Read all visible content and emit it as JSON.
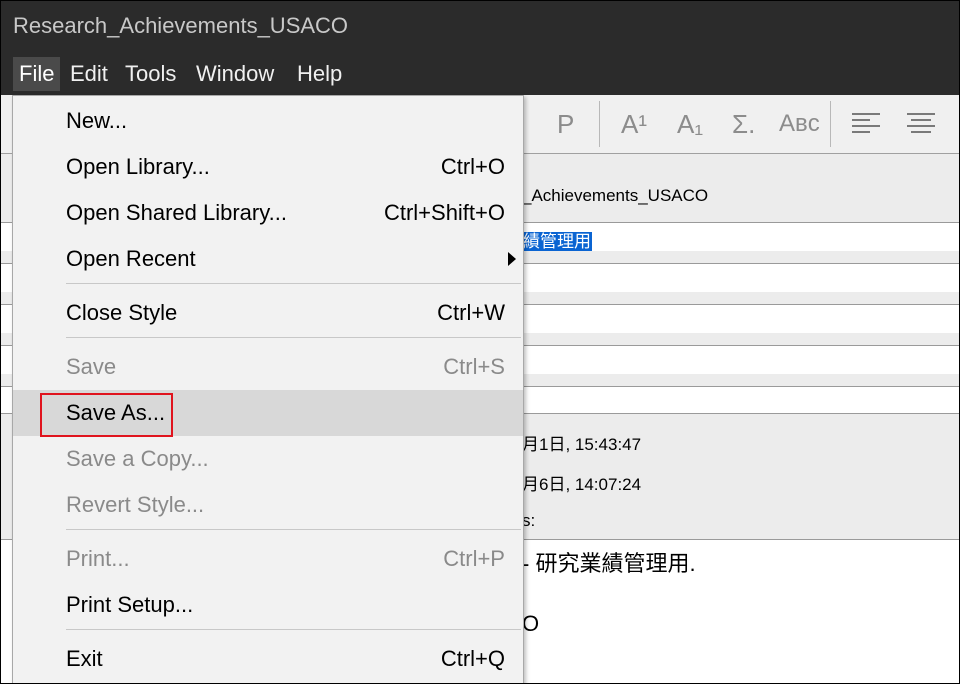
{
  "window": {
    "title": "Research_Achievements_USACO"
  },
  "menubar": {
    "items": [
      "File",
      "Edit",
      "Tools",
      "Window",
      "Help"
    ]
  },
  "toolbar": {
    "bold_glyph": "P",
    "superscript_glyph": "A¹",
    "subscript_glyph": "A₁",
    "symbol_glyph": "Σ.",
    "smallcaps_glyph": "Aʙᴄ"
  },
  "content": {
    "name_partial": "_Achievements_USACO",
    "selected_partial": "績管理用",
    "created_partial": "月1日, 15:43:47",
    "modified_partial": "月6日, 14:07:24",
    "label_partial": "s:",
    "description_partial": "- 研究業績管理用.",
    "extra_partial": "O"
  },
  "file_menu": {
    "new": "New...",
    "open_library": {
      "label": "Open Library...",
      "shortcut": "Ctrl+O"
    },
    "open_shared": {
      "label": "Open Shared Library...",
      "shortcut": "Ctrl+Shift+O"
    },
    "open_recent": "Open Recent",
    "close_style": {
      "label": "Close Style",
      "shortcut": "Ctrl+W"
    },
    "save": {
      "label": "Save",
      "shortcut": "Ctrl+S"
    },
    "save_as": "Save As...",
    "save_copy": "Save a Copy...",
    "revert": "Revert Style...",
    "print": {
      "label": "Print...",
      "shortcut": "Ctrl+P"
    },
    "print_setup": "Print Setup...",
    "exit": {
      "label": "Exit",
      "shortcut": "Ctrl+Q"
    }
  },
  "colors": {
    "titlebar": "#2b2b2b",
    "highlight": "#0a64d2",
    "annotation": "#e0141e"
  }
}
